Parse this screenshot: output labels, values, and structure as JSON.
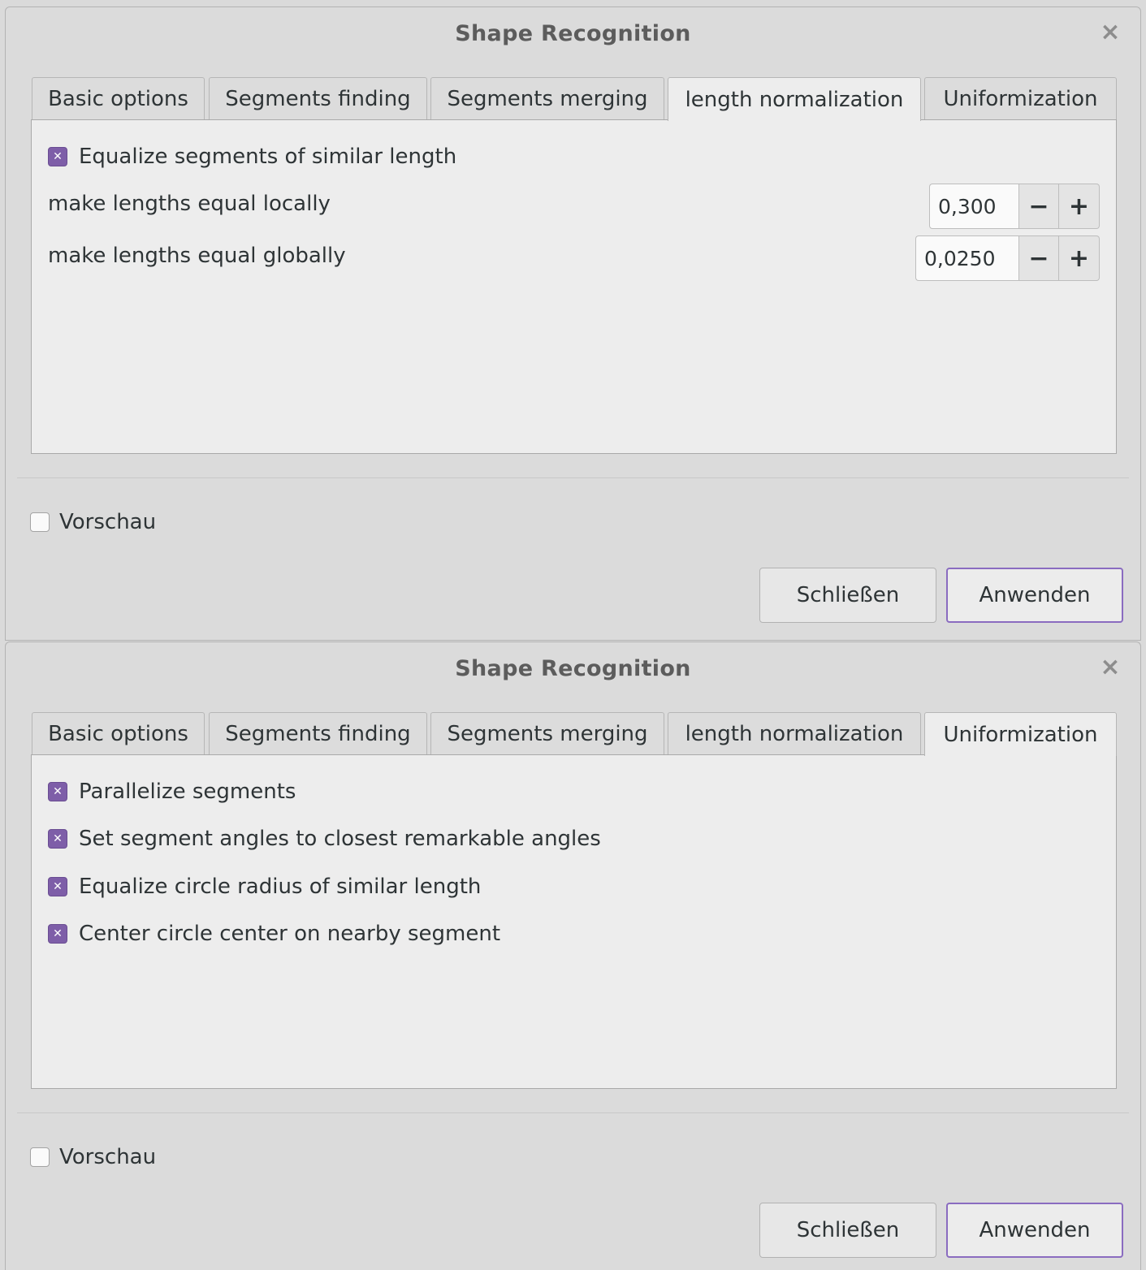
{
  "dialogs": [
    {
      "title": "Shape Recognition",
      "close_icon": "×",
      "tabs": [
        "Basic options",
        "Segments finding",
        "Segments merging",
        "length normalization",
        "Uniformization"
      ],
      "active_tab": "length normalization",
      "checkbox": {
        "label": "Equalize segments of similar length",
        "checked": true
      },
      "spinners": [
        {
          "label": "make lengths equal locally",
          "value": "0,300"
        },
        {
          "label": "make lengths equal globally",
          "value": "0,0250"
        }
      ],
      "minus_label": "−",
      "plus_label": "+",
      "preview": {
        "label": "Vorschau",
        "checked": false
      },
      "buttons": {
        "close": "Schließen",
        "apply": "Anwenden"
      }
    },
    {
      "title": "Shape Recognition",
      "close_icon": "×",
      "tabs": [
        "Basic options",
        "Segments finding",
        "Segments merging",
        "length normalization",
        "Uniformization"
      ],
      "active_tab": "Uniformization",
      "checkboxes": [
        {
          "label": "Parallelize segments",
          "checked": true
        },
        {
          "label": "Set segment angles to closest remarkable angles",
          "checked": true
        },
        {
          "label": "Equalize circle radius of similar length",
          "checked": true
        },
        {
          "label": "Center circle center on nearby segment",
          "checked": true
        }
      ],
      "preview": {
        "label": "Vorschau",
        "checked": false
      },
      "buttons": {
        "close": "Schließen",
        "apply": "Anwenden"
      }
    }
  ],
  "colors": {
    "accent": "#7e5ea8",
    "default_button_border": "#8a6cc0"
  },
  "icons": {
    "check_mark": "check-icon"
  }
}
